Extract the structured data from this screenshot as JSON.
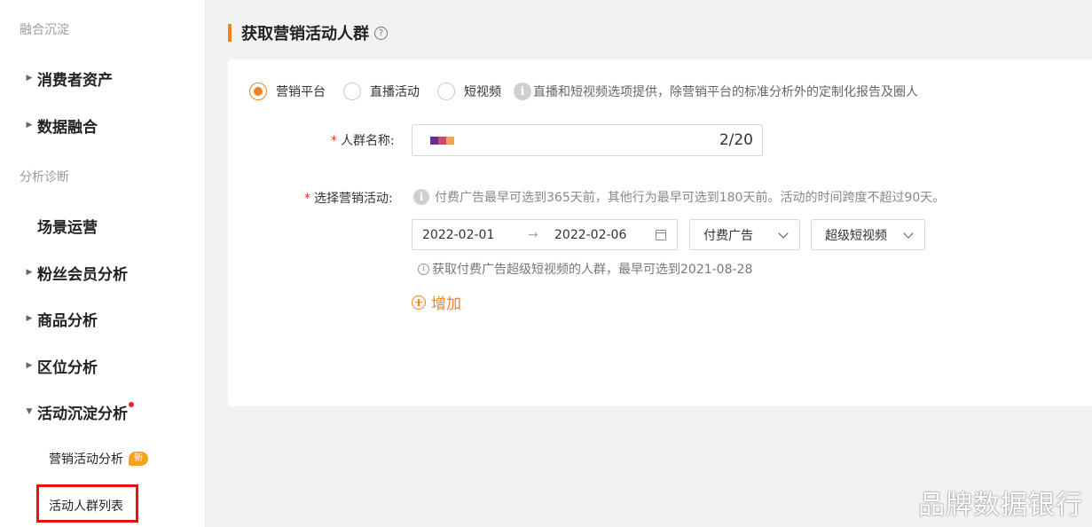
{
  "sidebar": {
    "sections": [
      {
        "title": "融合沉淀"
      },
      {
        "title": "分析诊断"
      }
    ],
    "items": [
      {
        "label": "消费者资产"
      },
      {
        "label": "数据融合"
      },
      {
        "label": "场景运营"
      },
      {
        "label": "粉丝会员分析"
      },
      {
        "label": "商品分析"
      },
      {
        "label": "区位分析"
      },
      {
        "label": "活动沉淀分析"
      }
    ],
    "sub_items": [
      {
        "label": "营销活动分析",
        "badge": "新"
      },
      {
        "label": "活动人群列表"
      }
    ]
  },
  "header": {
    "title": "获取营销活动人群",
    "help_icon": "?"
  },
  "form": {
    "radios": [
      {
        "label": "营销平台",
        "checked": true
      },
      {
        "label": "直播活动",
        "checked": false
      },
      {
        "label": "短视频",
        "checked": false
      }
    ],
    "radio_info_icon": "i",
    "radio_hint": "直播和短视频选项提供，除营销平台的标准分析外的定制化报告及圈人",
    "name_label": "人群名称:",
    "name_required": "*",
    "name_counter": "2/20",
    "activity_label": "选择营销活动:",
    "activity_required": "*",
    "activity_info_icon": "i",
    "activity_hint": "付费广告最早可选到365天前，其他行为最早可选到180天前。活动的时间跨度不超过90天。",
    "date_start": "2022-02-01",
    "date_arrow": "→",
    "date_end": "2022-02-06",
    "select_type": "付费广告",
    "select_subtype": "超级短视频",
    "sub_info_icon": "i",
    "sub_hint": "获取付费广告超级短视频的人群，最早可选到2021-08-28",
    "add_label": "增加"
  },
  "watermark": "品牌数据银行",
  "colors": {
    "accent": "#f58220",
    "required": "#f5222d",
    "badge": "#f7a21b",
    "highlight_box": "#e8130c",
    "swatch": [
      "#6b2c8f",
      "#c94c6f",
      "#f0a35a"
    ]
  }
}
